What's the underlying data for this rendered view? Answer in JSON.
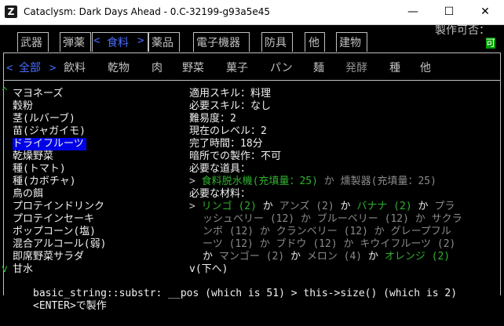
{
  "window": {
    "title": "Cataclysm: Dark Days Ahead - 0.C-32199-g93a5e45",
    "icon_letter": "Z",
    "minimize": "—",
    "maximize": "☐",
    "close": "✕"
  },
  "tabs": [
    "武器",
    "弾薬",
    "食料",
    "薬品",
    "電子機器",
    "防具",
    "他",
    "建物"
  ],
  "tab_arrows": {
    "left": "<",
    "right": ">"
  },
  "craftable": {
    "label": "製作可否：",
    "value": "可"
  },
  "subtabs": [
    "全部",
    "飲料",
    "乾物",
    "肉",
    "野菜",
    "菓子",
    "パン",
    "麺",
    "発酵",
    "種",
    "他"
  ],
  "recipes": [
    "マヨネーズ",
    "穀粉",
    "茎(ルバーブ)",
    "苗(ジャガイモ)",
    "ドライフルーツ",
    "乾燥野菜",
    "種(トマト)",
    "種(カボチャ)",
    "鳥の餌",
    "プロテインドリンク",
    "プロテインセーキ",
    "ポップコーン(塩)",
    "混合アルコール(弱)",
    "即席野菜サラダ",
    "甘水"
  ],
  "scroll_markers": {
    "top": "^",
    "bottom": "v"
  },
  "details": {
    "skill_used": "適用スキル：料理",
    "skill_required": "必要スキル：なし",
    "difficulty": "難易度：2",
    "current_level": "現在のレベル：2",
    "time": "完了時間：18分",
    "dark_craft": "暗所での製作：不可",
    "tools_header": "必要な道具：",
    "tool_prefix": ">",
    "tool_1": "食料脱水機(充填量：25)",
    "tool_or": "か",
    "tool_2": "燻製器(充填量：25)",
    "materials_header": "必要な材料：",
    "mat_line1_prefix": ">",
    "apple": "リンゴ (2)",
    "or": "か",
    "apricot": "アンズ (2)",
    "banana": "バナナ (2)",
    "mat_line1_end": "プラ",
    "mat_line2": "ッシュベリー (12) か ブルーベリー (12) か サクラ",
    "mat_line3": "ンボ (12) か クランベリー (12) か グレープフル",
    "mat_line4": "ーツ (12) か ブドウ (12) か キウイフルーツ (2)",
    "mat_line5_start": "か",
    "mango": "マンゴー (2)",
    "melon": "メロン (4)",
    "orange": "オレンジ (2)",
    "more": "v(下へ)"
  },
  "error_message": "basic_string::substr: __pos (which is 51) > this->size() (which is 2)",
  "craft_hint": "<ENTER>で製作"
}
